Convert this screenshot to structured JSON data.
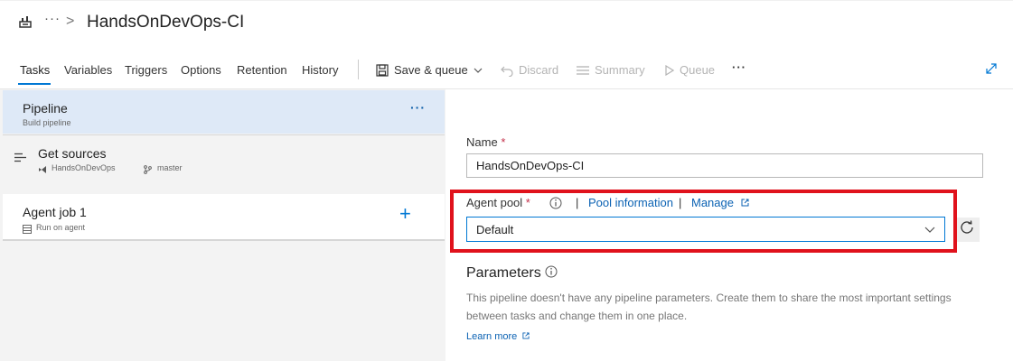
{
  "header": {
    "title": "HandsOnDevOps-CI",
    "more": "···",
    "chevron": ">"
  },
  "tabs": [
    {
      "label": "Tasks",
      "active": true
    },
    {
      "label": "Variables"
    },
    {
      "label": "Triggers"
    },
    {
      "label": "Options"
    },
    {
      "label": "Retention"
    },
    {
      "label": "History"
    }
  ],
  "toolbar": {
    "save_queue": "Save & queue",
    "discard": "Discard",
    "summary": "Summary",
    "queue": "Queue",
    "more": "···"
  },
  "left": {
    "pipeline": {
      "title": "Pipeline",
      "subtitle": "Build pipeline",
      "more": "···"
    },
    "get_sources": {
      "title": "Get sources",
      "repo": "HandsOnDevOps",
      "branch": "master"
    },
    "agent_job": {
      "title": "Agent job 1",
      "subtitle": "Run on agent",
      "add": "+"
    }
  },
  "form": {
    "name_label": "Name",
    "required_mark": "*",
    "name_value": "HandsOnDevOps-CI",
    "agent_pool_label": "Agent pool",
    "pipe1": "|",
    "pipe2": "|",
    "pool_information": "Pool information",
    "manage": "Manage",
    "agent_pool_value": "Default",
    "parameters_heading": "Parameters",
    "parameters_text": "This pipeline doesn't have any pipeline parameters. Create them to share the most important settings between tasks and change them in one place.",
    "learn_more": "Learn more"
  },
  "colors": {
    "accent": "#0078d4",
    "highlight_box": "#e0121c",
    "selected_row": "#dee9f7"
  }
}
